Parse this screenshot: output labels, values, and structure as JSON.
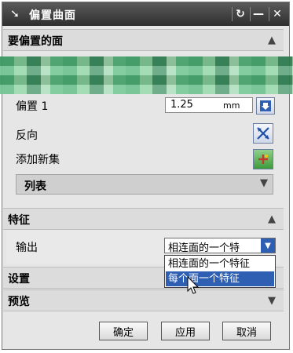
{
  "titlebar": {
    "title": "偏置曲面",
    "reset_glyph": "↻",
    "minimize_glyph": "—",
    "close_glyph": "✕"
  },
  "sections": {
    "faces": {
      "label": "要偏置的面",
      "state": "expanded"
    },
    "features": {
      "label": "特征",
      "state": "expanded"
    },
    "settings": {
      "label": "设置",
      "state": "collapsed"
    },
    "preview": {
      "label": "预览",
      "state": "collapsed"
    }
  },
  "offset": {
    "label": "偏置 1",
    "value": "1.25",
    "unit": "mm"
  },
  "reverse": {
    "label": "反向"
  },
  "add_set": {
    "label": "添加新集"
  },
  "list": {
    "label": "列表"
  },
  "output": {
    "label": "输出",
    "selected": "相连面的一个特",
    "options": [
      "相连面的一个特征",
      "每个面一个特征"
    ],
    "highlighted_index": 1
  },
  "buttons": {
    "ok": "确定",
    "apply": "应用",
    "cancel": "取消"
  },
  "icons": {
    "app": "arrow-cursor-icon",
    "reverse": "flip-arrows-icon",
    "add_set": "add-set-icon",
    "dropdown": "arrow-down-icon"
  }
}
